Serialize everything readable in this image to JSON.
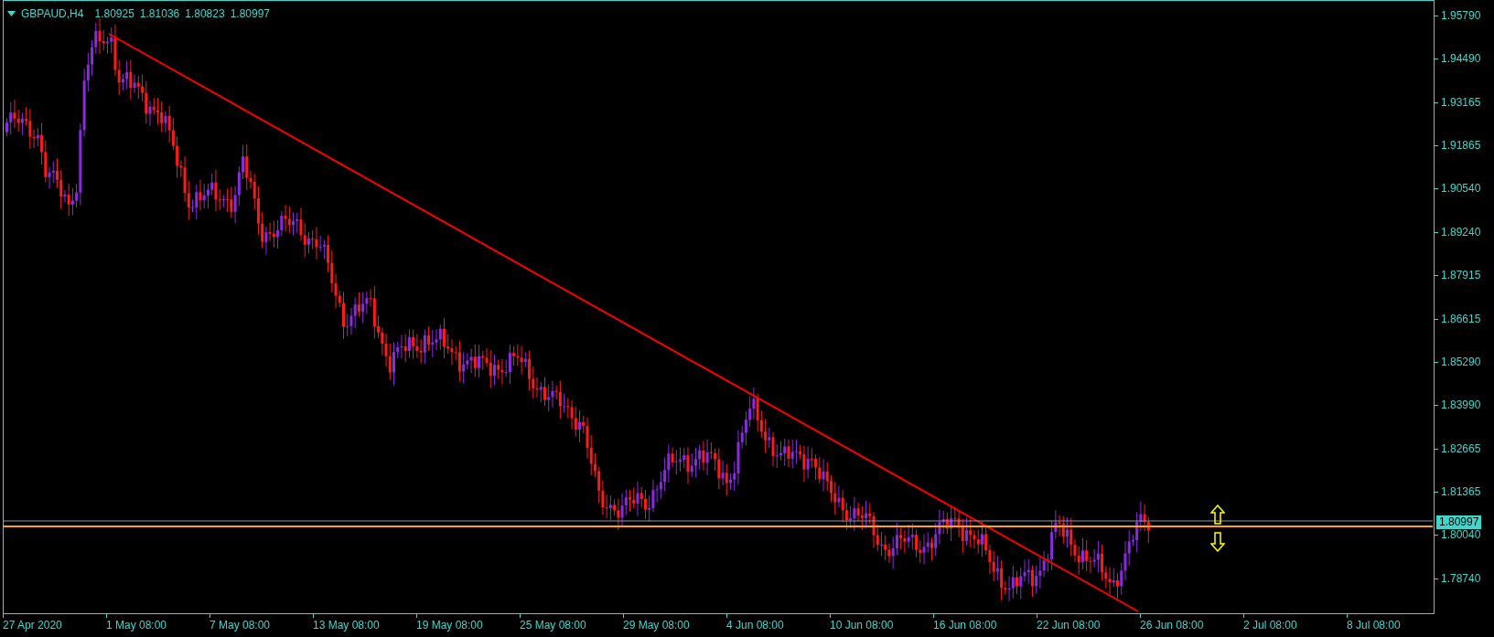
{
  "chart_header": {
    "symbol": "GBPAUD,H4",
    "quotes": [
      "1.80925",
      "1.81036",
      "1.80823",
      "1.80997"
    ]
  },
  "price_axis": {
    "labels": [
      "1.95790",
      "1.94490",
      "1.93165",
      "1.91865",
      "1.90540",
      "1.89240",
      "1.87915",
      "1.86615",
      "1.85290",
      "1.83990",
      "1.82665",
      "1.81365",
      "1.80040",
      "1.78740"
    ],
    "current_price": "1.80997"
  },
  "time_axis": {
    "labels": [
      "27 Apr 2020",
      "1 May 08:00",
      "7 May 08:00",
      "13 May 08:00",
      "19 May 08:00",
      "25 May 08:00",
      "29 May 08:00",
      "4 Jun 08:00",
      "10 Jun 08:00",
      "16 Jun 08:00",
      "22 Jun 08:00",
      "26 Jun 08:00",
      "2 Jul 08:00",
      "8 Jul 08:00"
    ]
  }
}
